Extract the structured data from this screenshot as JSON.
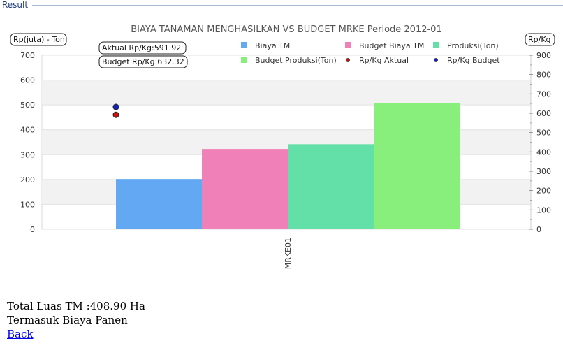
{
  "section": {
    "title": "Result"
  },
  "chart_data": {
    "type": "bar",
    "title": "BIAYA TANAMAN MENGHASILKAN VS BUDGET MRKE Periode 2012-01",
    "left_axis_label": "Rp(juta) - Ton",
    "right_axis_label": "Rp/Kg",
    "categories": [
      "MRKE01"
    ],
    "ylim_left": [
      0,
      700
    ],
    "yticks_left": [
      0,
      100,
      200,
      300,
      400,
      500,
      600,
      700
    ],
    "ylim_right": [
      0,
      900
    ],
    "yticks_right": [
      0,
      100,
      200,
      300,
      400,
      500,
      600,
      700,
      800,
      900
    ],
    "grid": true,
    "legend_position": "top",
    "series": [
      {
        "name": "Biaya TM",
        "values": [
          202
        ],
        "color": "#62a8f3",
        "axis": "left"
      },
      {
        "name": "Budget Biaya TM",
        "values": [
          323
        ],
        "color": "#f080b8",
        "axis": "left"
      },
      {
        "name": "Produksi(Ton)",
        "values": [
          342
        ],
        "color": "#62e0a8",
        "axis": "left"
      },
      {
        "name": "Budget Produksi(Ton)",
        "values": [
          507
        ],
        "color": "#88ee7c",
        "axis": "left"
      }
    ],
    "points": [
      {
        "name": "Rp/Kg Aktual",
        "value": 591.92,
        "color": "#cc1111",
        "axis": "right"
      },
      {
        "name": "Rp/Kg Budget",
        "value": 632.32,
        "color": "#1122cc",
        "axis": "right"
      }
    ],
    "annotations": [
      "Aktual Rp/Kg:591.92",
      "Budget Rp/Kg:632.32"
    ]
  },
  "footer": {
    "total_luas": "Total Luas TM :408.90 Ha",
    "note": "Termasuk Biaya Panen",
    "back_link": "Back"
  }
}
